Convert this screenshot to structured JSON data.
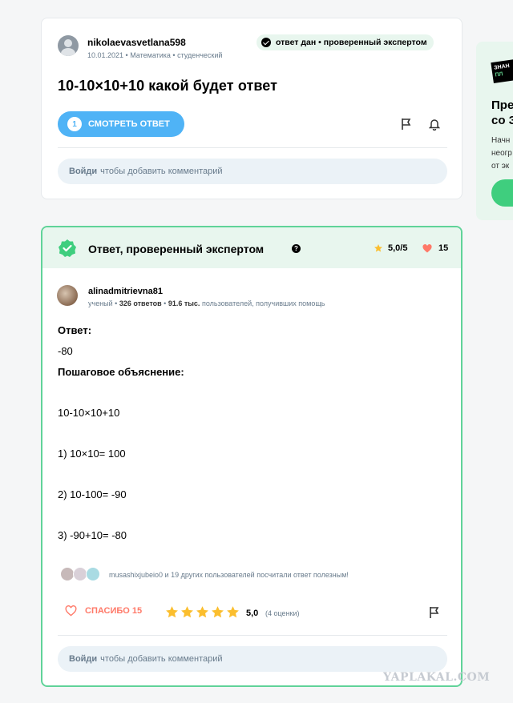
{
  "question": {
    "author": "nikolaevasvetlana598",
    "meta": "10.01.2021 • Математика • студенческий",
    "status_badge": "ответ дан • проверенный экспертом",
    "title": "10-10×10+10 какой будет ответ",
    "see_answer_count": "1",
    "see_answer_label": "СМОТРЕТЬ ОТВЕТ",
    "comment_login": "Войди",
    "comment_text": "чтобы добавить комментарий"
  },
  "side_panel": {
    "logo_line1": "ЗНАН",
    "logo_line2": "ПЛ",
    "title": "Пре\nсо З",
    "text": "Начн\nнеогр\nот эк"
  },
  "answer": {
    "header_title": "Ответ, проверенный экспертом",
    "help_icon": "?",
    "rating": "5,0/5",
    "likes": "15",
    "author": "alinadmitrievna81",
    "meta_rank": "ученый",
    "meta_answers": "326 ответов",
    "meta_people": "91.6 тыс.",
    "meta_people_suffix": "пользователей, получивших помощь",
    "lines": {
      "answer_label": "Ответ:",
      "answer_value": "-80",
      "explanation_label": "Пошаговое объяснение:",
      "expression": "10-10×10+10",
      "step1": "1) 10×10= 100",
      "step2": "2) 10-100= -90",
      "step3": "3) -90+10= -80"
    },
    "helpers_text": "musashixjubeio0 и 19 других пользователей посчитали ответ полезным!",
    "thanks_label": "СПАСИБО 15",
    "stars_value": 5,
    "rating_value": "5,0",
    "rating_count": "(4 оценки)",
    "comment_login": "Войди",
    "comment_text": "чтобы добавить комментарий"
  },
  "watermark": "YAPLAKAL.COM",
  "colors": {
    "accent_blue": "#4fb3f6",
    "verified_green": "#60d399",
    "heart_red": "#ff7968",
    "star_yellow": "#fbbe2e"
  }
}
